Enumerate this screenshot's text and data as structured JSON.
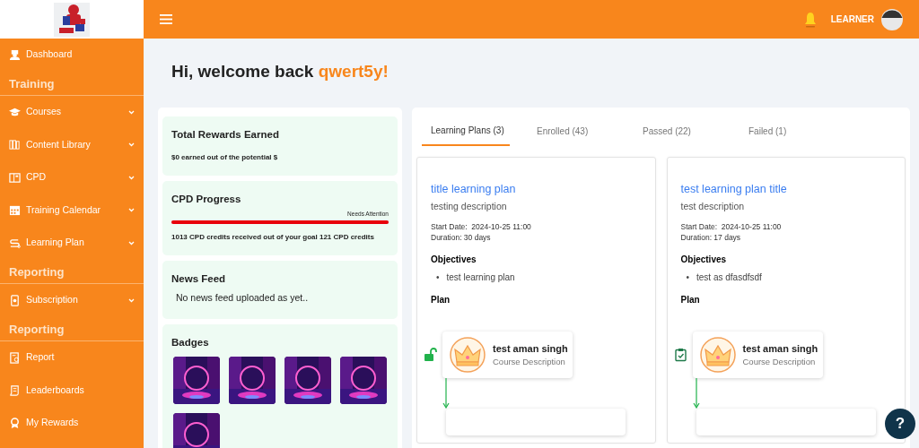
{
  "header": {
    "user": "LEARNER"
  },
  "sidebar": {
    "items": [
      {
        "kind": "link",
        "label": "Dashboard",
        "expandable": false
      },
      {
        "kind": "heading",
        "label": "Training"
      },
      {
        "kind": "link",
        "label": "Courses",
        "expandable": true
      },
      {
        "kind": "link",
        "label": "Content Library",
        "expandable": true
      },
      {
        "kind": "link",
        "label": "CPD",
        "expandable": true
      },
      {
        "kind": "link",
        "label": "Training Calendar",
        "expandable": true
      },
      {
        "kind": "link",
        "label": "Learning Plan",
        "expandable": true
      },
      {
        "kind": "heading",
        "label": "Reporting"
      },
      {
        "kind": "link",
        "label": "Subscription",
        "expandable": true
      },
      {
        "kind": "heading",
        "label": "Reporting"
      },
      {
        "kind": "link",
        "label": "Report",
        "expandable": false
      },
      {
        "kind": "link",
        "label": "Leaderboards",
        "expandable": false
      },
      {
        "kind": "link",
        "label": "My Rewards",
        "expandable": false
      }
    ]
  },
  "welcome": {
    "greeting": "Hi, welcome back",
    "username": "qwert5y!"
  },
  "rewards": {
    "title": "Total Rewards Earned",
    "text": "$0 earned out of the potential $"
  },
  "cpd": {
    "title": "CPD Progress",
    "status": "Needs Attention",
    "level": 1,
    "text": "1013 CPD credits received out of your goal 121 CPD credits"
  },
  "news": {
    "title": "News Feed",
    "text": "No news feed uploaded as yet.."
  },
  "badges": {
    "title": "Badges"
  },
  "tabs": [
    {
      "label": "Learning Plans (3)",
      "selected": true
    },
    {
      "label": "Enrolled (43)",
      "selected": false
    },
    {
      "label": "Passed (22)",
      "selected": false
    },
    {
      "label": "Failed (1)",
      "selected": false
    }
  ],
  "plans": [
    {
      "title": "title learning plan",
      "description": "testing description",
      "start_label": "Start Date:",
      "start": "2024-10-25 11:00",
      "duration": "Duration: 30 days",
      "objectives_title": "Objectives",
      "objectives": [
        {
          "marker": "•",
          "text": "test learning plan"
        }
      ],
      "plan_title": "Plan",
      "course": {
        "kind": "unlocked",
        "title": "test aman singh",
        "description": "Course Description"
      }
    },
    {
      "title": "test learning plan title",
      "description": "test description",
      "start_label": "Start Date:",
      "start": "2024-10-25 11:00",
      "duration": "Duration: 17 days",
      "objectives_title": "Objectives",
      "objectives": [
        {
          "marker": "•",
          "text": "test as dfasdfsdf"
        }
      ],
      "plan_title": "Plan",
      "course": {
        "kind": "assigned",
        "title": "test aman singh",
        "description": "Course Description"
      }
    }
  ],
  "help": "?"
}
